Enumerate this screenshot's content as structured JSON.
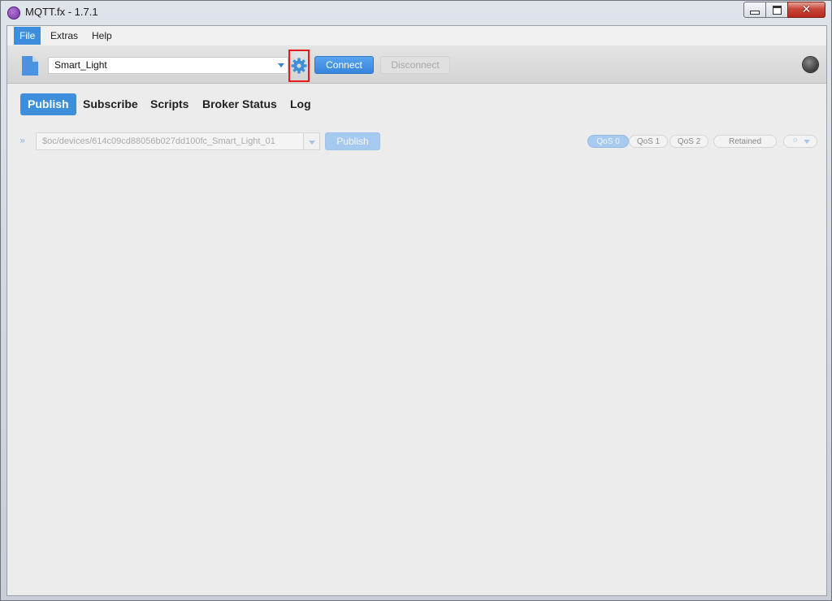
{
  "window": {
    "title": "MQTT.fx - 1.7.1",
    "controls": {
      "minimize": "minimize",
      "maximize": "maximize",
      "close": "✕"
    }
  },
  "menu": {
    "items": [
      {
        "label": "File",
        "active": true
      },
      {
        "label": "Extras",
        "active": false
      },
      {
        "label": "Help",
        "active": false
      }
    ]
  },
  "toolbar": {
    "profile_value": "Smart_Light",
    "connect_label": "Connect",
    "disconnect_label": "Disconnect",
    "accent_color": "#3d8fdc",
    "highlight_color": "#e51c1c"
  },
  "tabs": [
    {
      "label": "Publish",
      "active": true
    },
    {
      "label": "Subscribe",
      "active": false
    },
    {
      "label": "Scripts",
      "active": false
    },
    {
      "label": "Broker Status",
      "active": false
    },
    {
      "label": "Log",
      "active": false
    }
  ],
  "publish": {
    "expand_glyph": "»",
    "topic_value": "$oc/devices/614c09cd88056b027dd100fc_Smart_Light_01",
    "publish_label": "Publish",
    "qos": [
      {
        "label": "QoS 0",
        "selected": true
      },
      {
        "label": "QoS 1",
        "selected": false
      },
      {
        "label": "QoS 2",
        "selected": false
      }
    ],
    "retained_label": "Retained",
    "extra_label": "o"
  }
}
